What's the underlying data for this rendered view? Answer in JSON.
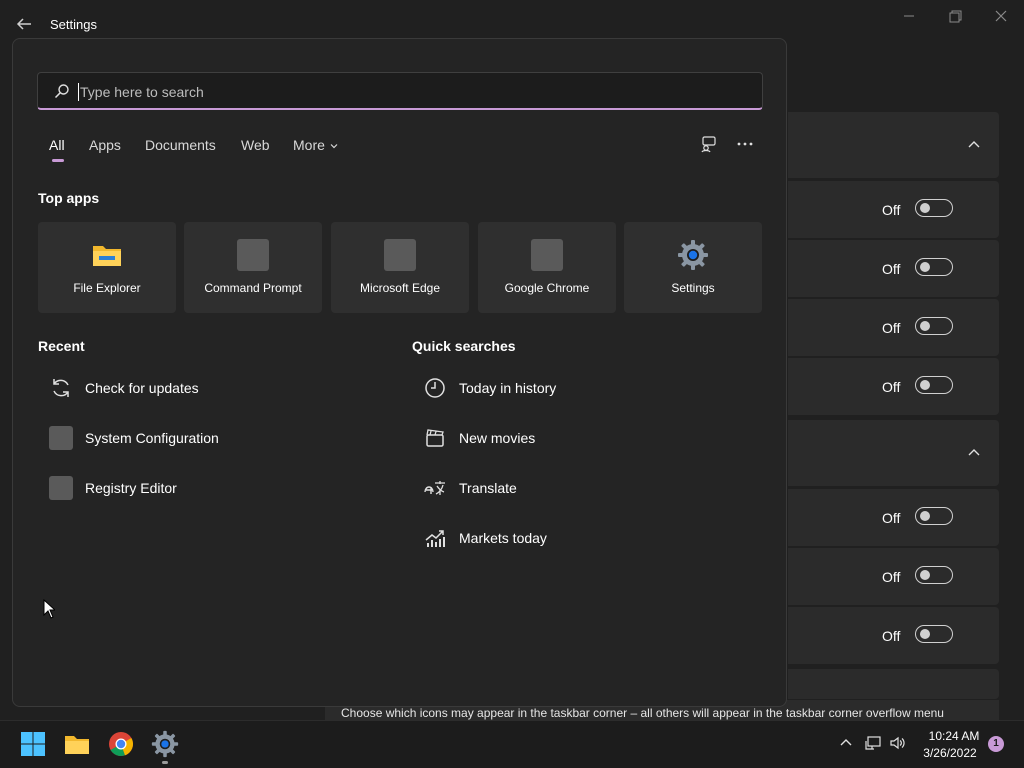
{
  "window": {
    "title": "Settings"
  },
  "search": {
    "placeholder": "Type here to search"
  },
  "tabs": [
    {
      "label": "All"
    },
    {
      "label": "Apps"
    },
    {
      "label": "Documents"
    },
    {
      "label": "Web"
    },
    {
      "label": "More"
    }
  ],
  "top_apps": {
    "title": "Top apps",
    "items": [
      {
        "label": "File Explorer",
        "icon": "folder-icon"
      },
      {
        "label": "Command Prompt",
        "icon": "command-prompt-icon"
      },
      {
        "label": "Microsoft Edge",
        "icon": "edge-icon"
      },
      {
        "label": "Google Chrome",
        "icon": "chrome-icon"
      },
      {
        "label": "Settings",
        "icon": "settings-gear-icon"
      }
    ]
  },
  "recent": {
    "title": "Recent",
    "items": [
      {
        "label": "Check for updates",
        "icon": "refresh-icon"
      },
      {
        "label": "System Configuration",
        "icon": "system-config-icon"
      },
      {
        "label": "Registry Editor",
        "icon": "registry-icon"
      }
    ]
  },
  "quick_searches": {
    "title": "Quick searches",
    "items": [
      {
        "label": "Today in history",
        "icon": "clock-icon"
      },
      {
        "label": "New movies",
        "icon": "clapperboard-icon"
      },
      {
        "label": "Translate",
        "icon": "translate-icon"
      },
      {
        "label": "Markets today",
        "icon": "chart-icon"
      }
    ]
  },
  "settings_rows": {
    "off_label": "Off"
  },
  "footer": {
    "text": "Choose which icons may appear in the taskbar corner – all others will appear in the taskbar corner overflow menu"
  },
  "taskbar": {
    "time": "10:24 AM",
    "date": "3/26/2022",
    "notifications": "1"
  },
  "colors": {
    "accent": "#c89ad6",
    "background": "#202020",
    "panel": "#242424",
    "tile": "#2f2f2f"
  }
}
